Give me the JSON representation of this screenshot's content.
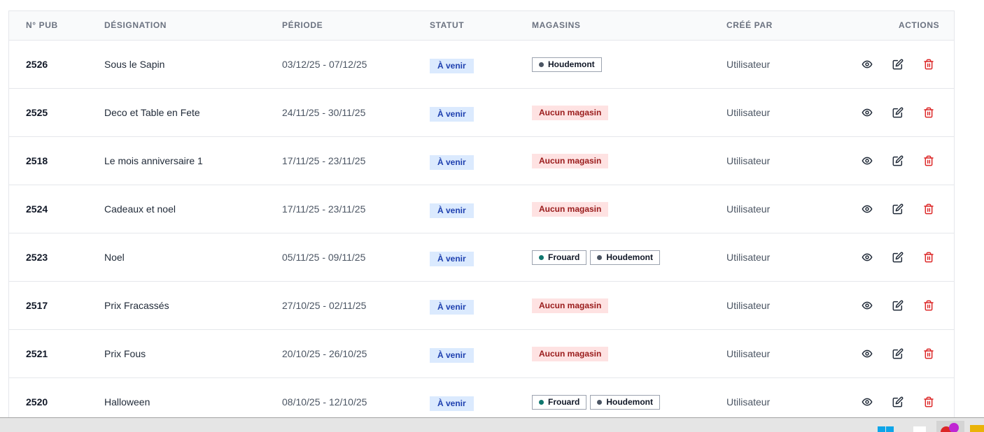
{
  "table": {
    "headers": {
      "num": "N° PUB",
      "designation": "DÉSIGNATION",
      "period": "PÉRIODE",
      "status": "STATUT",
      "stores": "MAGASINS",
      "created_by": "CRÉÉ PAR",
      "actions": "ACTIONS"
    },
    "rows": [
      {
        "num": "2526",
        "designation": "Sous le Sapin",
        "period": "03/12/25 - 07/12/25",
        "status": "À venir",
        "stores": [
          "Houdemont"
        ],
        "no_store": "",
        "created_by": "Utilisateur"
      },
      {
        "num": "2525",
        "designation": "Deco et Table en Fete",
        "period": "24/11/25 - 30/11/25",
        "status": "À venir",
        "stores": [],
        "no_store": "Aucun magasin",
        "created_by": "Utilisateur"
      },
      {
        "num": "2518",
        "designation": "Le mois anniversaire 1",
        "period": "17/11/25 - 23/11/25",
        "status": "À venir",
        "stores": [],
        "no_store": "Aucun magasin",
        "created_by": "Utilisateur"
      },
      {
        "num": "2524",
        "designation": "Cadeaux et noel",
        "period": "17/11/25 - 23/11/25",
        "status": "À venir",
        "stores": [],
        "no_store": "Aucun magasin",
        "created_by": "Utilisateur"
      },
      {
        "num": "2523",
        "designation": "Noel",
        "period": "05/11/25 - 09/11/25",
        "status": "À venir",
        "stores": [
          "Frouard",
          "Houdemont"
        ],
        "no_store": "",
        "created_by": "Utilisateur"
      },
      {
        "num": "2517",
        "designation": "Prix Fracassés",
        "period": "27/10/25 - 02/11/25",
        "status": "À venir",
        "stores": [],
        "no_store": "Aucun magasin",
        "created_by": "Utilisateur"
      },
      {
        "num": "2521",
        "designation": "Prix Fous",
        "period": "20/10/25 - 26/10/25",
        "status": "À venir",
        "stores": [],
        "no_store": "Aucun magasin",
        "created_by": "Utilisateur"
      },
      {
        "num": "2520",
        "designation": "Halloween",
        "period": "08/10/25 - 12/10/25",
        "status": "À venir",
        "stores": [
          "Frouard",
          "Houdemont"
        ],
        "no_store": "",
        "created_by": "Utilisateur"
      }
    ]
  },
  "store_colors": {
    "Houdemont": "#4b5563",
    "Frouard": "#0f766e"
  },
  "colors": {
    "delete": "#dc2626",
    "icon": "#1f2937",
    "status_bg": "#dbeafe",
    "status_fg": "#1e40af"
  },
  "icons": {
    "view": "eye-icon",
    "edit": "edit-icon",
    "delete": "trash-icon"
  }
}
